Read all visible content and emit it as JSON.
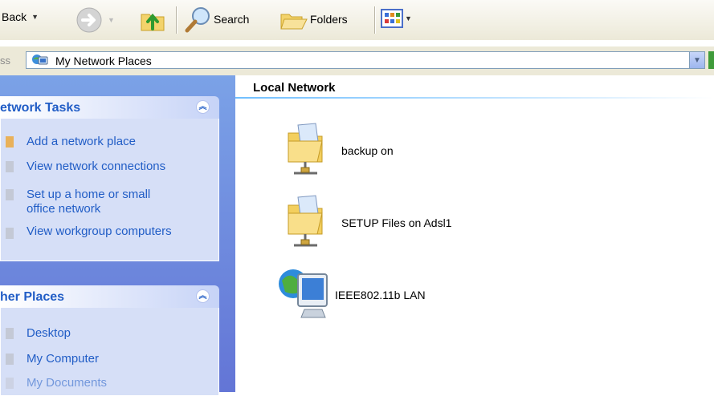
{
  "toolbar": {
    "back_label": "Back",
    "search_label": "Search",
    "folders_label": "Folders"
  },
  "address": {
    "label": "ss",
    "value": "My Network Places"
  },
  "network_tasks": {
    "title": "etwork Tasks",
    "items": [
      {
        "label": "Add a network place"
      },
      {
        "label": "View network connections"
      },
      {
        "label_line1": "Set up a home or small",
        "label_line2": "office network"
      },
      {
        "label": "View workgroup computers"
      }
    ]
  },
  "other_places": {
    "title": "her Places",
    "items": [
      {
        "label": "Desktop"
      },
      {
        "label": "My Computer"
      },
      {
        "label": "My Documents"
      }
    ]
  },
  "main": {
    "group_title": "Local Network",
    "items": [
      {
        "label": "backup on",
        "icon": "network-share-folder-icon"
      },
      {
        "label": "SETUP Files on Adsl1",
        "icon": "network-share-folder-icon"
      },
      {
        "label": "IEEE802.11b LAN",
        "icon": "network-computer-icon"
      }
    ]
  },
  "colors": {
    "link": "#215dc6",
    "pane_bg_top": "#7ba2e7",
    "pane_bg_bottom": "#6375d6",
    "panel_body": "#d6dff7"
  }
}
